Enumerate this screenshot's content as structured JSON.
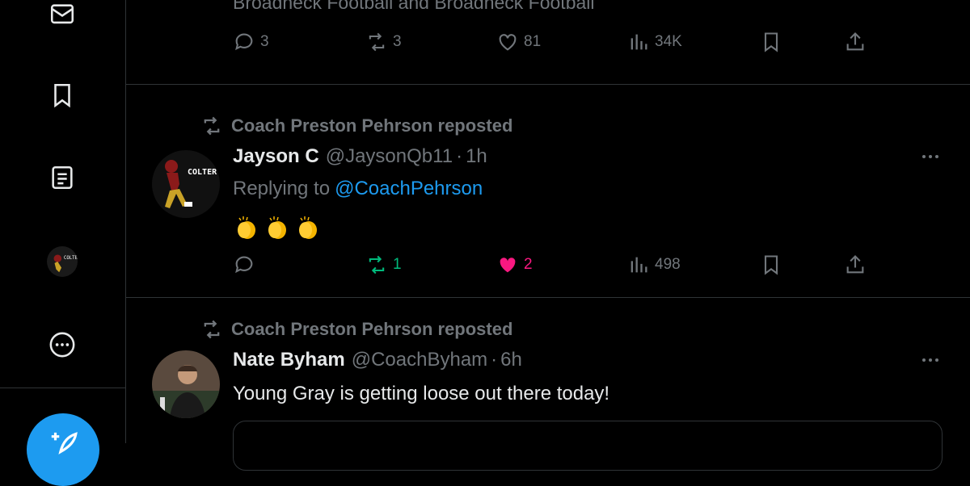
{
  "sidebar": {
    "icons": [
      "mail-icon",
      "bookmark-icon",
      "lists-icon",
      "profile-avatar",
      "more-icon",
      "compose-icon"
    ]
  },
  "previous_tweet": {
    "partial_text": "Broadneck Football and Broadneck Football",
    "actions": {
      "replies": "3",
      "reposts": "3",
      "likes": "81",
      "views": "34K"
    }
  },
  "tweets": [
    {
      "repost_label": "Coach Preston Pehrson reposted",
      "name": "Jayson C",
      "handle": "@JaysonQb11",
      "time": "1h",
      "reply_prefix": "Replying to",
      "reply_mention": "@CoachPehrson",
      "body": "👏👏👏",
      "actions": {
        "replies": "",
        "reposts": "1",
        "likes": "2",
        "views": "498"
      },
      "avatar_text": "COLTER"
    },
    {
      "repost_label": "Coach Preston Pehrson reposted",
      "name": "Nate Byham",
      "handle": "@CoachByham",
      "time": "6h",
      "body": "Young Gray is getting loose out there today!"
    }
  ],
  "colors": {
    "background": "#000000",
    "text": "#e7e9ea",
    "muted": "#71767b",
    "accent": "#1d9bf0",
    "repost_green": "#00ba7c",
    "like_pink": "#f91880",
    "border": "#2f3336"
  },
  "separator_dot": "·"
}
